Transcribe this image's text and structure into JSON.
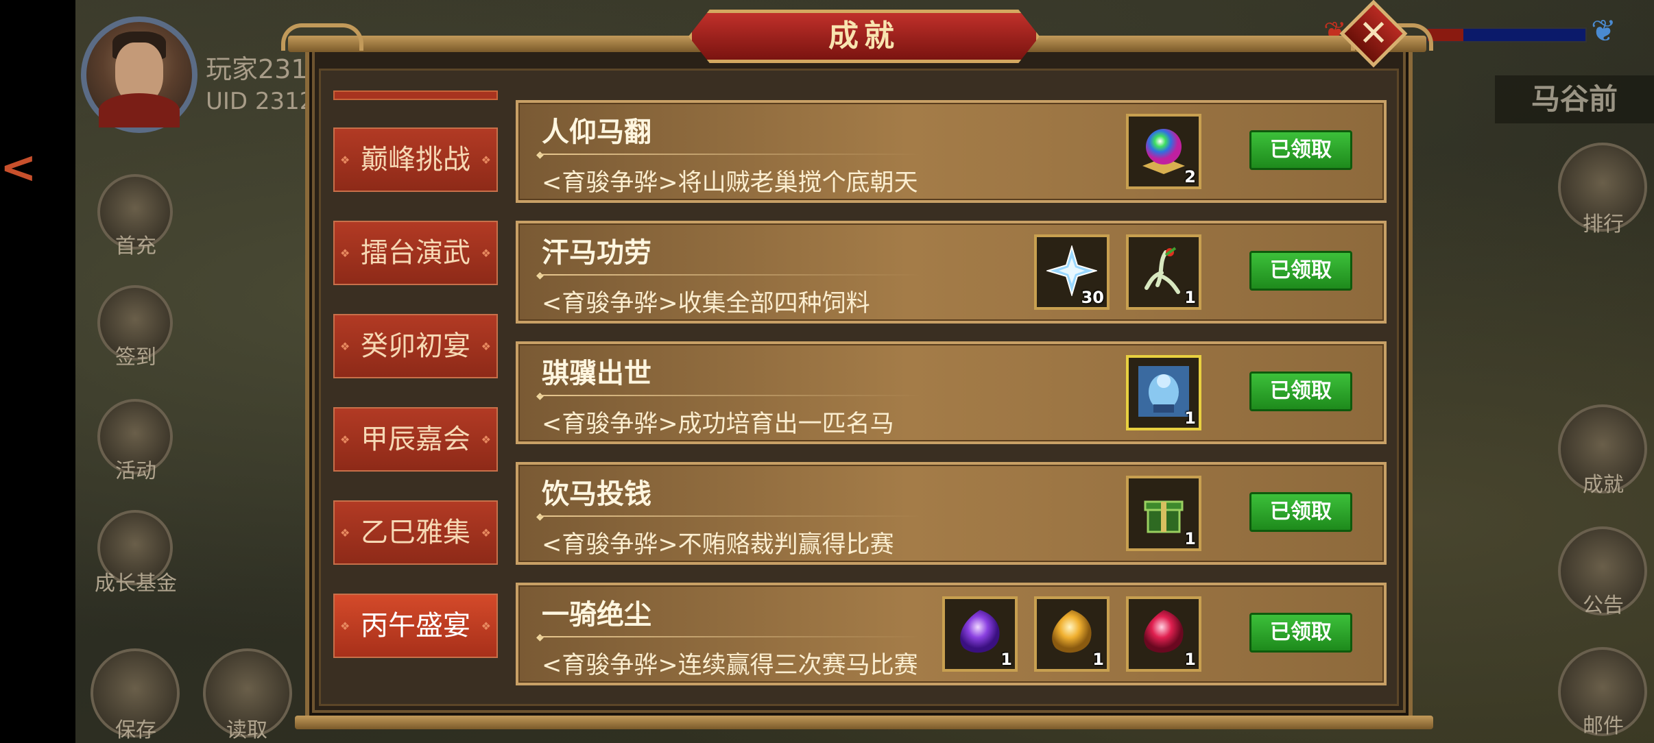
{
  "player": {
    "name": "玩家231",
    "uid": "UID  2312"
  },
  "region": "马谷前",
  "panel_title": "成就",
  "left_buttons": [
    {
      "label": "首充"
    },
    {
      "label": "签到"
    },
    {
      "label": "活动"
    },
    {
      "label": "成长基金"
    },
    {
      "label": "保存"
    },
    {
      "label": "读取"
    }
  ],
  "right_buttons": [
    {
      "label": "排行"
    },
    {
      "label": "成就"
    },
    {
      "label": "公告"
    },
    {
      "label": "邮件"
    }
  ],
  "tabs": [
    {
      "label": "巅峰挑战",
      "active": false
    },
    {
      "label": "擂台演武",
      "active": false
    },
    {
      "label": "癸卯初宴",
      "active": false
    },
    {
      "label": "甲辰嘉会",
      "active": false
    },
    {
      "label": "乙巳雅集",
      "active": false
    },
    {
      "label": "丙午盛宴",
      "active": true
    }
  ],
  "achievements": [
    {
      "title": "人仰马翻",
      "desc": "<育骏争骅>将山贼老巢搅个底朝天",
      "rewards": [
        {
          "icon": "rainbow-orb-icon",
          "count": "2"
        }
      ],
      "button": "已领取"
    },
    {
      "title": "汗马功劳",
      "desc": "<育骏争骅>收集全部四种饲料",
      "rewards": [
        {
          "icon": "ice-crystal-icon",
          "count": "30"
        },
        {
          "icon": "ginseng-icon",
          "count": "1"
        }
      ],
      "button": "已领取"
    },
    {
      "title": "骐骥出世",
      "desc": "<育骏争骅>成功培育出一匹名马",
      "rewards": [
        {
          "icon": "horse-card-icon",
          "count": "1"
        }
      ],
      "button": "已领取"
    },
    {
      "title": "饮马投钱",
      "desc": "<育骏争骅>不贿赂裁判赢得比赛",
      "rewards": [
        {
          "icon": "green-box-icon",
          "count": "1"
        }
      ],
      "button": "已领取"
    },
    {
      "title": "一骑绝尘",
      "desc": "<育骏争骅>连续赢得三次赛马比赛",
      "rewards": [
        {
          "icon": "purple-gem-icon",
          "count": "1"
        },
        {
          "icon": "gold-gem-icon",
          "count": "1"
        },
        {
          "icon": "red-gem-icon",
          "count": "1"
        }
      ],
      "button": "已领取"
    }
  ],
  "colors": {
    "accent_red": "#b23a24",
    "claimed_green": "#2ea62c",
    "frame_gold": "#c8a066"
  }
}
